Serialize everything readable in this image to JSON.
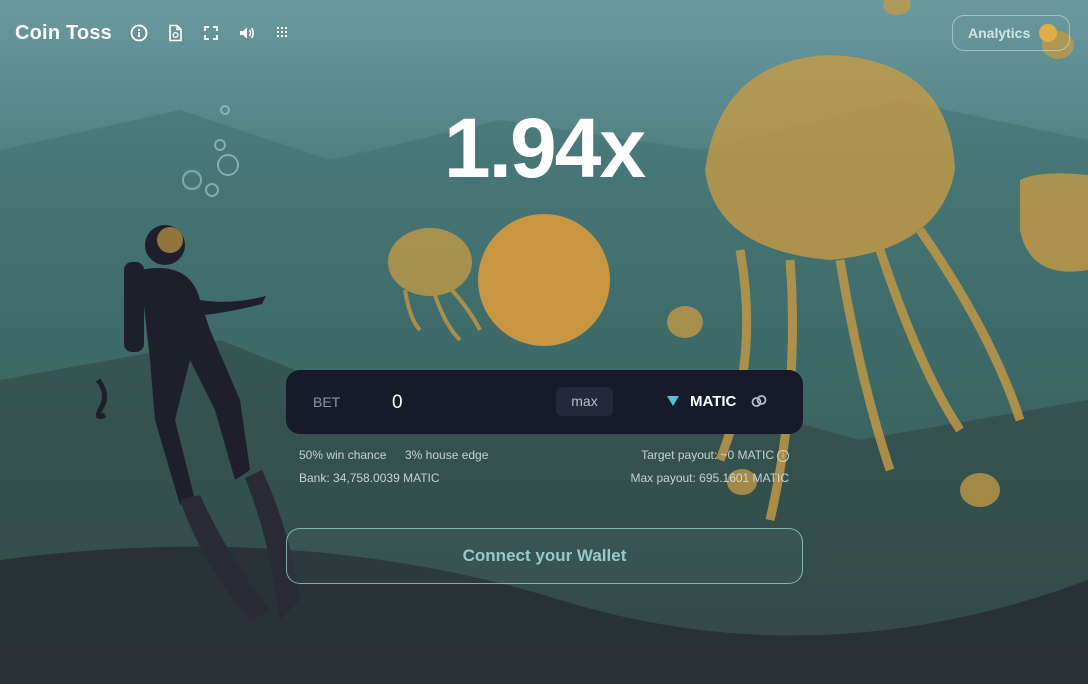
{
  "app": {
    "title": "Coin Toss"
  },
  "toolbar": {
    "icons": [
      "info-icon",
      "document-icon",
      "fullscreen-icon",
      "sound-icon",
      "grid-icon"
    ]
  },
  "analytics": {
    "label": "Analytics"
  },
  "game": {
    "multiplier": "1.94x"
  },
  "bet": {
    "label": "BET",
    "value": "0",
    "max_label": "max",
    "token": "MATIC"
  },
  "stats": {
    "win_chance": "50% win chance",
    "house_edge": "3% house edge",
    "bank": "Bank: 34,758.0039 MATIC",
    "target_payout": "Target payout: ~0 MATIC",
    "max_payout": "Max payout: 695.1601 MATIC"
  },
  "connect": {
    "label": "Connect your Wallet"
  },
  "colors": {
    "coin": "#c89642",
    "accent": "#4fc1d6",
    "panel": "#161a2b"
  }
}
